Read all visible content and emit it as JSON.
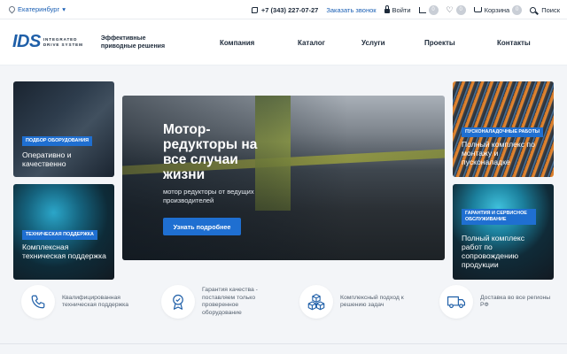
{
  "topbar": {
    "city": "Екатеринбург",
    "phone": "+7 (343) 227-07-27",
    "callback": "Заказать звонок",
    "login": "Войти",
    "compare_count": "0",
    "favorites_count": "0",
    "cart_label": "Корзина",
    "cart_count": "0",
    "search_label": "Поиск"
  },
  "header": {
    "logo_mark": "IDS",
    "logo_line1": "INTEGRATED",
    "logo_line2": "DRIVE SYSTEM",
    "tagline": "Эффективные приводные решения",
    "nav": [
      "Компания",
      "Каталог",
      "Услуги",
      "Проекты",
      "Контакты"
    ]
  },
  "cards": [
    {
      "tag": "Подбор оборудования",
      "title": "Оперативно и качественно"
    },
    {
      "tag": "Техническая поддержка",
      "title": "Комплексная техническая поддержка"
    },
    {
      "tag": "Пусконаладочные работы",
      "title": "Полный комплекс по монтажу и пусконаладке"
    },
    {
      "tag": "Гарантия и сервисное обслуживание",
      "title": "Полный комплекс работ по сопровождению продукции"
    }
  ],
  "hero": {
    "title": "Мотор-редукторы на все случаи жизни",
    "subtitle": "мотор редукторы от ведущих производителей",
    "button": "Узнать подробнее"
  },
  "features": [
    {
      "icon": "phone-icon",
      "text": "Квалифицированная техническая поддержка"
    },
    {
      "icon": "quality-badge-icon",
      "text": "Гарантия качества - поставляем только проверенное оборудование"
    },
    {
      "icon": "cubes-icon",
      "text": "Комплексный подход к решению задач"
    },
    {
      "icon": "truck-icon",
      "text": "Доставка во все регионы РФ"
    }
  ],
  "colors": {
    "accent": "#1f6fd1",
    "link": "#1a5fb4",
    "text": "#1d2a3a"
  }
}
